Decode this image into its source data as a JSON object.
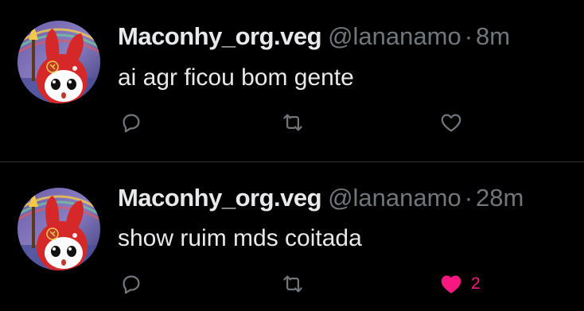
{
  "colors": {
    "background": "#000000",
    "text": "#e7e9ea",
    "secondary_text": "#71767b",
    "divider": "#2f3336",
    "like_active": "#f91880"
  },
  "tweets": [
    {
      "display_name": "Maconhy_org.veg",
      "handle": "@lananamo",
      "separator": "·",
      "time": "8m",
      "text": "ai agr ficou bom gente",
      "liked": false,
      "like_count": ""
    },
    {
      "display_name": "Maconhy_org.veg",
      "handle": "@lananamo",
      "separator": "·",
      "time": "28m",
      "text": "show ruim mds coitada",
      "liked": true,
      "like_count": "2"
    }
  ],
  "icons": {
    "reply": "reply-icon",
    "retweet": "retweet-icon",
    "like": "heart-icon"
  }
}
